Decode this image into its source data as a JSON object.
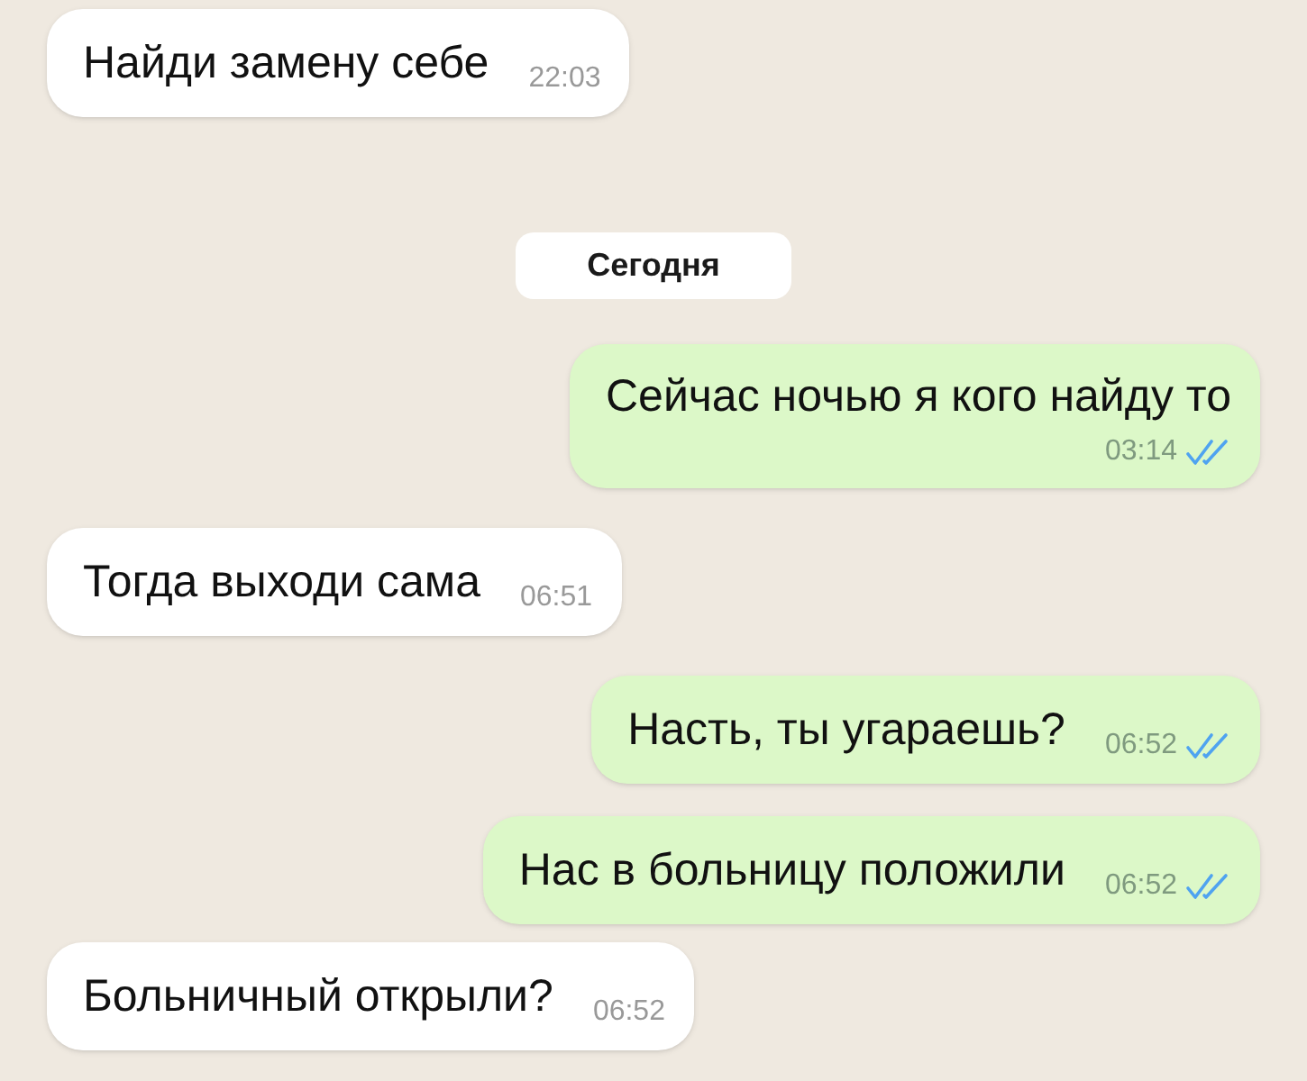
{
  "messages": [
    {
      "kind": "message",
      "outgoing": false,
      "text": "Найди замену себе",
      "time": "22:03"
    },
    {
      "kind": "date",
      "text": "Сегодня"
    },
    {
      "kind": "message",
      "outgoing": true,
      "text": "Сейчас ночью я кого найду то",
      "time": "03:14",
      "read": true,
      "wrap": true
    },
    {
      "kind": "message",
      "outgoing": false,
      "text": "Тогда выходи сама",
      "time": "06:51"
    },
    {
      "kind": "message",
      "outgoing": true,
      "text": "Насть, ты угараешь?",
      "time": "06:52",
      "read": true
    },
    {
      "kind": "message",
      "outgoing": true,
      "text": "Нас в больницу положили",
      "time": "06:52",
      "read": true
    },
    {
      "kind": "message",
      "outgoing": false,
      "text": "Больничный открыли?",
      "time": "06:52"
    }
  ]
}
